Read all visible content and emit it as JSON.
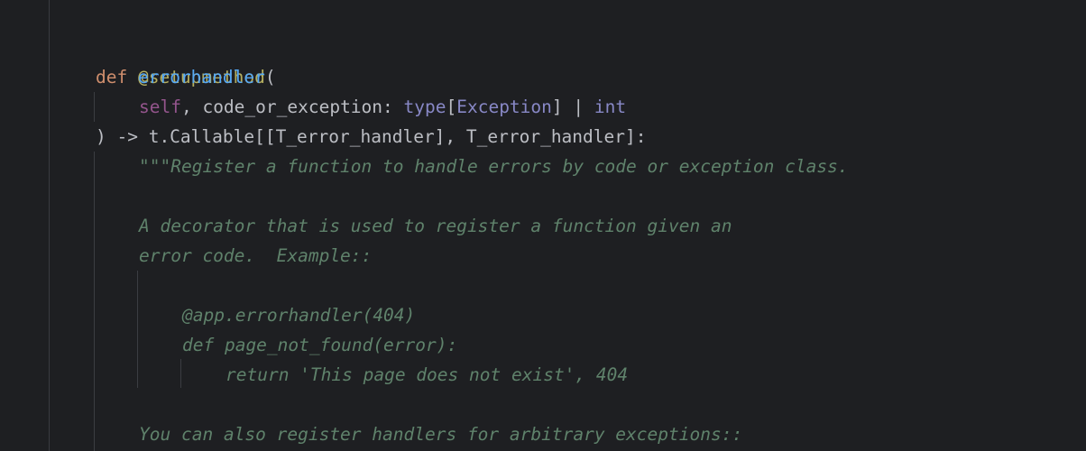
{
  "lines": {
    "l1": {
      "decorator": "@setupmethod"
    },
    "l2": {
      "kw": "def",
      "name": "errorhandler",
      "paren": "("
    },
    "l3": {
      "self": "self",
      "comma": ", code_or_exception: ",
      "type1": "type",
      "br1": "[",
      "exc": "Exception",
      "br2": "] | ",
      "int": "int"
    },
    "l4": {
      "text": ") -> t.Callable[[T_error_handler], T_error_handler]:"
    },
    "l5": {
      "text": "\"\"\"Register a function to handle errors by code or exception class."
    },
    "l7": {
      "text": "A decorator that is used to register a function given an"
    },
    "l8": {
      "text": "error code.  Example::"
    },
    "l10": {
      "text": "@app.errorhandler(404)"
    },
    "l11": {
      "text": "def page_not_found(error):"
    },
    "l12": {
      "text": "return 'This page does not exist', 404"
    },
    "l14": {
      "text": "You can also register handlers for arbitrary exceptions::"
    }
  }
}
